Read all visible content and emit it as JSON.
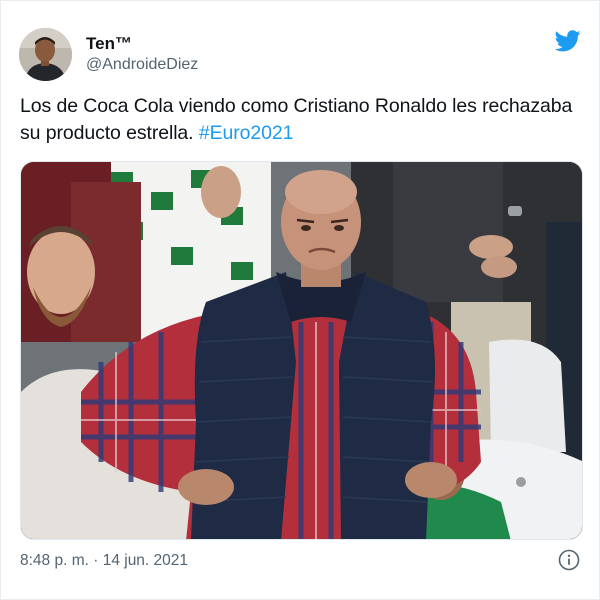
{
  "tweet": {
    "author": {
      "display_name": "Ten™",
      "handle": "@AndroideDiez",
      "avatar": "person-avatar"
    },
    "text": "Los de Coca Cola viendo como Cristiano Ronaldo les rechazaba su producto estrella.",
    "hashtag": "#Euro2021",
    "timestamp": "8:48 p. m. · 14 jun. 2021",
    "media": {
      "description_icon": "photo",
      "type": "photo"
    },
    "icons": {
      "platform": "bird-icon",
      "info": "info-icon"
    },
    "colors": {
      "accent": "#1d9bf0",
      "text": "#0f1419",
      "secondary": "#536471"
    }
  }
}
